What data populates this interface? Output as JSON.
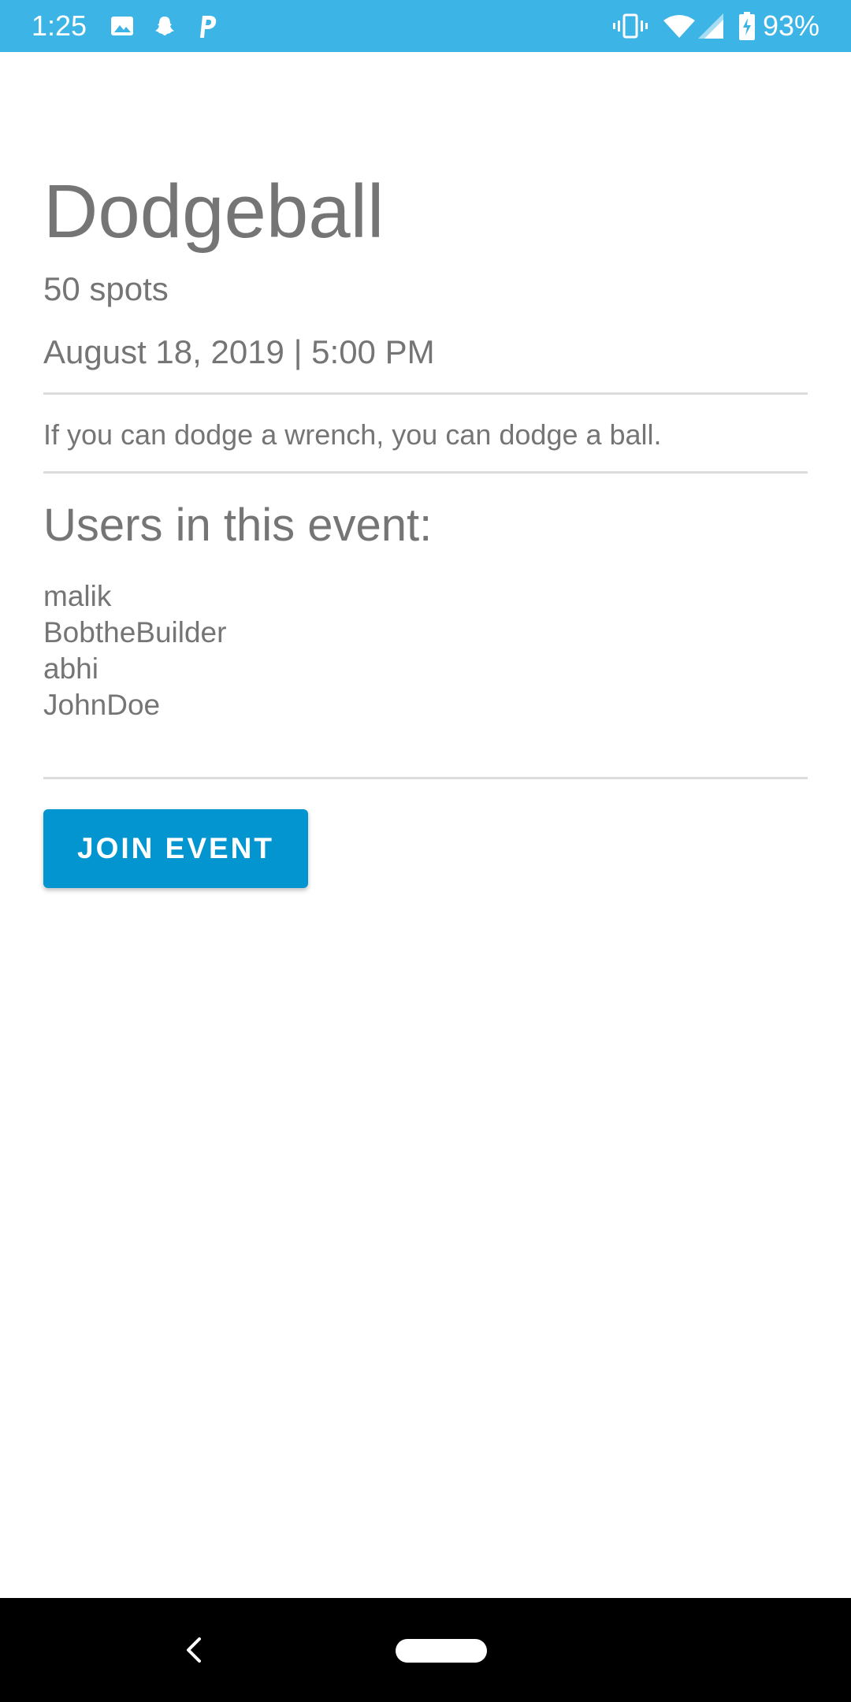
{
  "status_bar": {
    "time": "1:25",
    "battery": "93%",
    "left_icons": [
      "image-icon",
      "snapchat-icon",
      "parking-icon"
    ],
    "right_icons": [
      "vibrate-icon",
      "wifi-icon",
      "signal-icon",
      "battery-icon"
    ],
    "background": "#3cb4e5"
  },
  "event": {
    "title": "Dodgeball",
    "spots": "50 spots",
    "datetime": "August 18, 2019 | 5:00 PM",
    "description": "If you can dodge a wrench, you can dodge a ball."
  },
  "users": {
    "heading": "Users in this event:",
    "list": [
      "malik",
      "BobtheBuilder",
      "abhi",
      "JohnDoe"
    ]
  },
  "actions": {
    "join_label": "JOIN EVENT",
    "accent": "#0295cf"
  },
  "nav_bar": {
    "icons": [
      "back-icon",
      "home-pill-icon"
    ]
  }
}
